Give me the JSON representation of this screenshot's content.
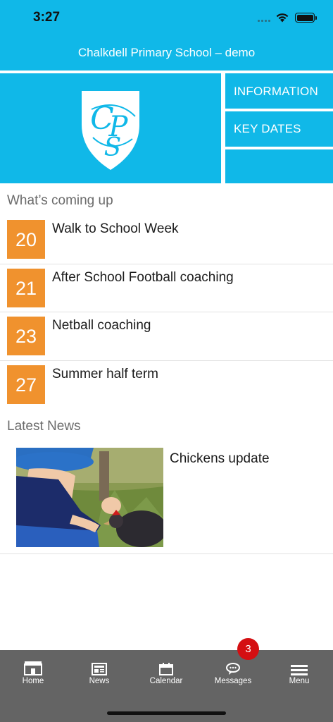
{
  "status_bar": {
    "time": "3:27"
  },
  "header": {
    "title": "Chalkdell Primary School – demo"
  },
  "hero": {
    "logo_name": "school-crest-logo",
    "logo_letters": "CPS"
  },
  "side_buttons": {
    "information": "INFORMATION",
    "key_dates": "KEY DATES"
  },
  "coming_up": {
    "title": "What’s coming up",
    "events": [
      {
        "day": "20",
        "title": "Walk to School Week"
      },
      {
        "day": "21",
        "title": "After School Football coaching"
      },
      {
        "day": "23",
        "title": "Netball coaching"
      },
      {
        "day": "27",
        "title": "Summer half term"
      }
    ]
  },
  "news": {
    "title": "Latest News",
    "items": [
      {
        "title": "Chickens update",
        "image": "child-feeding-chicken-photo"
      }
    ]
  },
  "tab_bar": {
    "tabs": [
      {
        "label": "Home",
        "icon": "home-icon"
      },
      {
        "label": "News",
        "icon": "news-icon"
      },
      {
        "label": "Calendar",
        "icon": "calendar-icon"
      },
      {
        "label": "Messages",
        "icon": "messages-icon"
      },
      {
        "label": "Menu",
        "icon": "menu-icon"
      }
    ],
    "messages_badge": "3"
  },
  "colors": {
    "primary": "#10b8e8",
    "date_box": "#f0922e",
    "tab_bar": "#646464",
    "badge": "#d40f12"
  }
}
